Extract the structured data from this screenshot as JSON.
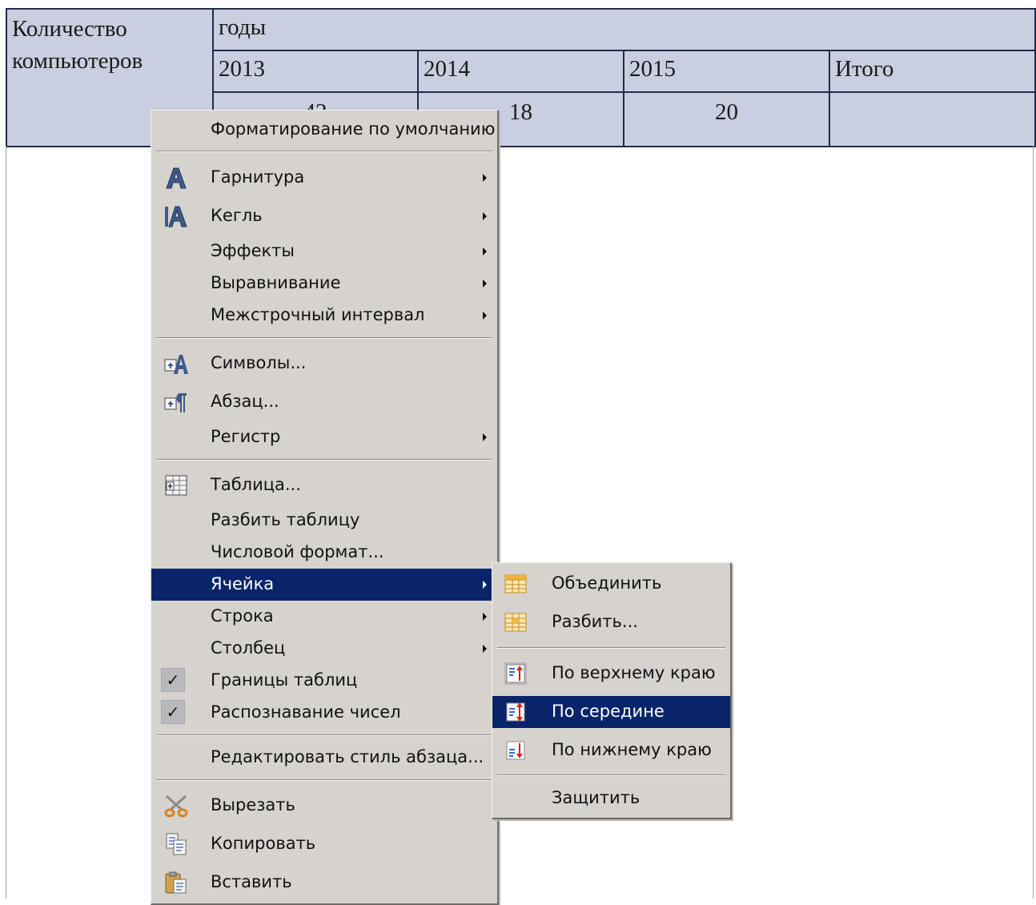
{
  "table": {
    "header_label": "Количество компьютеров",
    "group_label": "годы",
    "years": [
      "2013",
      "2014",
      "2015",
      "Итого"
    ],
    "values": [
      "42",
      "18",
      "20",
      ""
    ]
  },
  "main_menu": {
    "items": [
      {
        "label": "Форматирование по умолчанию"
      },
      {
        "label": "Гарнитура",
        "icon": "font-icon"
      },
      {
        "label": "Кегль",
        "icon": "font-size-icon"
      },
      {
        "label": "Эффекты"
      },
      {
        "label": "Выравнивание"
      },
      {
        "label": "Межстрочный интервал"
      },
      {
        "label": "Символы...",
        "icon": "character-icon"
      },
      {
        "label": "Абзац...",
        "icon": "paragraph-icon"
      },
      {
        "label": "Регистр"
      },
      {
        "label": "Таблица...",
        "icon": "table-icon"
      },
      {
        "label": "Разбить таблицу"
      },
      {
        "label": "Числовой формат..."
      },
      {
        "label": "Ячейка",
        "state": "highlighted"
      },
      {
        "label": "Строка"
      },
      {
        "label": "Столбец"
      },
      {
        "label": "Границы таблиц",
        "checked": true
      },
      {
        "label": "Распознавание чисел",
        "checked": true
      },
      {
        "label": "Редактировать стиль абзаца..."
      },
      {
        "label": "Вырезать",
        "icon": "scissors-icon"
      },
      {
        "label": "Копировать",
        "icon": "copy-icon"
      },
      {
        "label": "Вставить",
        "icon": "paste-icon"
      }
    ]
  },
  "sub_menu": {
    "items": [
      {
        "label": "Объединить",
        "icon": "merge-cells-icon"
      },
      {
        "label": "Разбить...",
        "icon": "split-cells-icon"
      },
      {
        "label": "По верхнему краю",
        "icon": "align-top-icon"
      },
      {
        "label": "По середине",
        "icon": "align-middle-icon",
        "state": "highlighted"
      },
      {
        "label": "По нижнему краю",
        "icon": "align-bottom-icon"
      },
      {
        "label": "Защитить"
      }
    ]
  },
  "colors": {
    "menu_bg": "#d6d3ce",
    "highlight": "#0a246a",
    "table_bg": "#c9cee0",
    "table_border": "#1f2d4a"
  }
}
